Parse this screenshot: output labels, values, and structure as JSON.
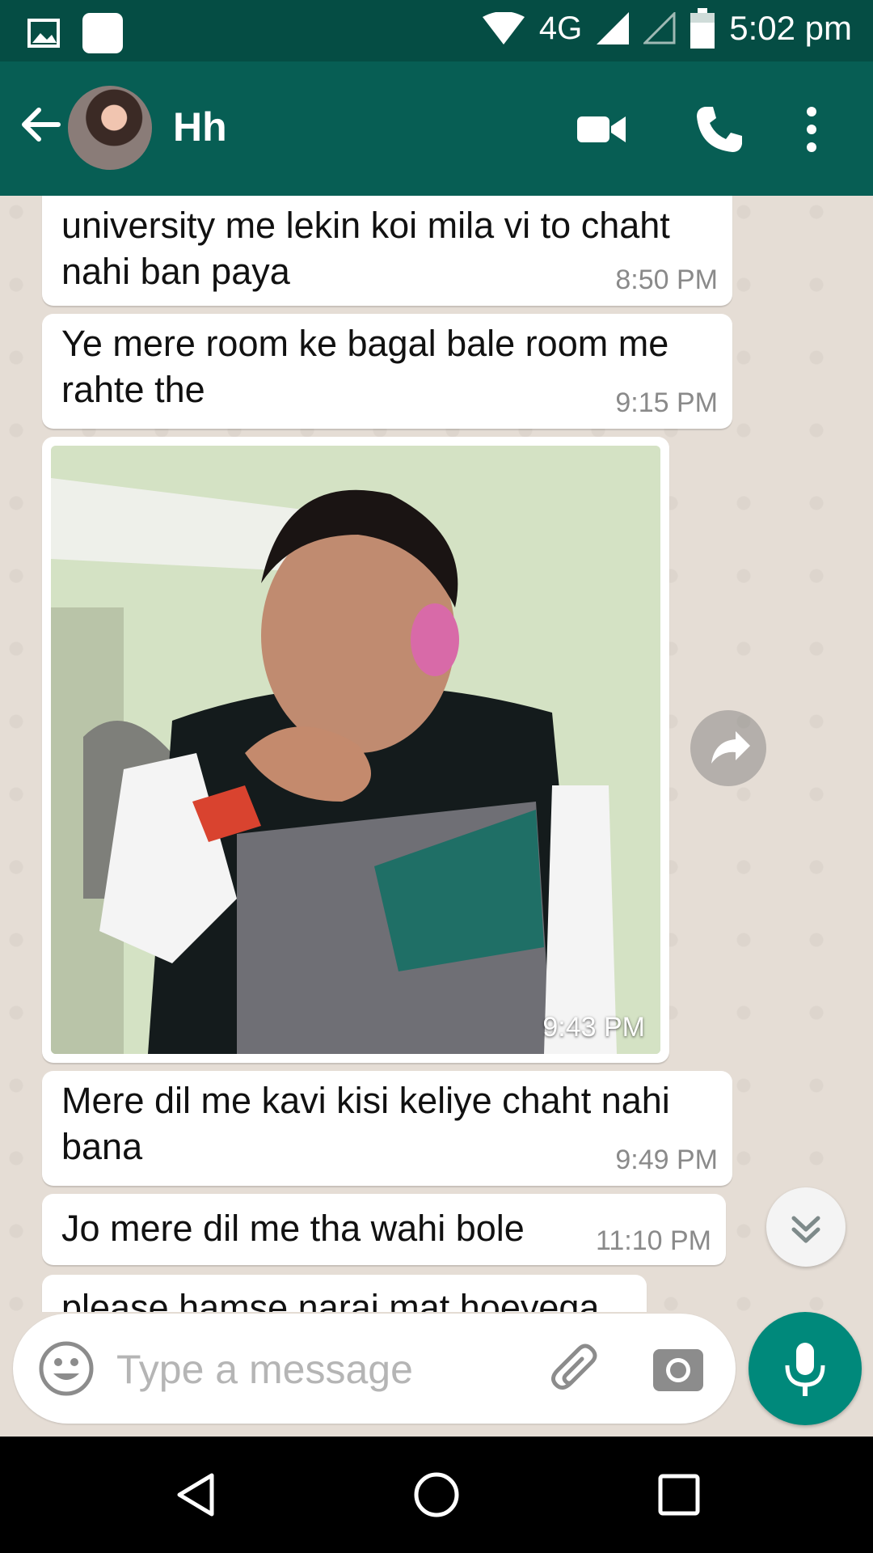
{
  "status_bar": {
    "network": "4G",
    "time": "5:02 pm"
  },
  "header": {
    "contact_name": "Hh"
  },
  "messages": [
    {
      "text": "university me lekin koi mila vi to chaht\nnahi ban paya",
      "time": "8:50 PM"
    },
    {
      "text": "Ye mere room ke bagal bale room me\nrahte the",
      "time": "9:15 PM"
    },
    {
      "type": "image",
      "time": "9:43 PM"
    },
    {
      "text": "Mere dil me kavi kisi keliye chaht nahi\nbana",
      "time": "9:49 PM"
    },
    {
      "text": "Jo mere dil me tha wahi bole",
      "time": "11:10 PM"
    },
    {
      "text": "please hamse narai mat hoeyega",
      "time": ""
    }
  ],
  "composer": {
    "placeholder": "Type a message"
  },
  "icons": {
    "status_left": [
      "gallery-icon",
      "app-icon"
    ],
    "status_right": [
      "wifi-icon",
      "signal-icon",
      "signal-empty-icon",
      "battery-icon"
    ],
    "header": [
      "back-arrow-icon",
      "video-call-icon",
      "voice-call-icon",
      "more-options-icon"
    ],
    "chat": [
      "forward-icon",
      "scroll-down-icon"
    ],
    "composer": [
      "emoji-icon",
      "attach-icon",
      "camera-icon",
      "mic-icon"
    ],
    "navigation": [
      "nav-back-icon",
      "nav-home-icon",
      "nav-recents-icon"
    ]
  },
  "colors": {
    "header": "#075e54",
    "status_bar": "#054d44",
    "accent": "#00897b",
    "chat_bg": "#e5ddd5",
    "bubble": "#ffffff"
  }
}
